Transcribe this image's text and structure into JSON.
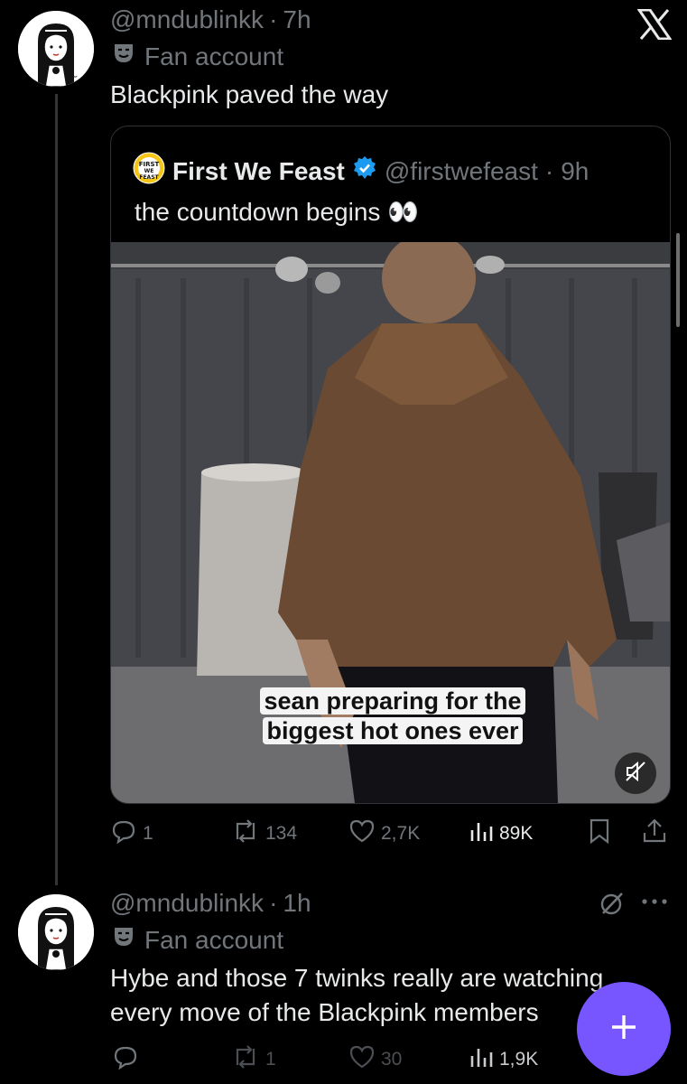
{
  "tweet1": {
    "handle": "@mndublinkk",
    "sep": "·",
    "time": "7h",
    "fan_label": "Fan account",
    "text": "Blackpink paved the way"
  },
  "quote": {
    "name": "First We Feast",
    "handle": "@firstwefeast",
    "sep": "·",
    "time": "9h",
    "text": "the countdown begins 👀",
    "caption_line1": "sean preparing for the",
    "caption_line2": "biggest hot ones ever",
    "avatar_text": "FIRST WE FEAST"
  },
  "tweet1_actions": {
    "replies": "1",
    "reposts": "134",
    "likes": "2,7K",
    "views": "89K"
  },
  "tweet2": {
    "handle": "@mndublinkk",
    "sep": "·",
    "time": "1h",
    "fan_label": "Fan account",
    "text_line1": "Hybe and those 7 twinks really are watching",
    "text_line2": "every move of the Blackpink members"
  },
  "tweet2_actions": {
    "reposts": "1",
    "likes": "30",
    "views": "1,9K"
  },
  "colors": {
    "background": "#000000",
    "text": "#e7e9ea",
    "muted": "#71767b",
    "accent": "#7856ff",
    "verified": "#1d9bf0"
  },
  "icons": [
    "x-logo-icon",
    "theater-mask-icon",
    "verified-badge-icon",
    "reply-icon",
    "repost-icon",
    "like-icon",
    "views-icon",
    "bookmark-icon",
    "share-icon",
    "grok-icon",
    "more-icon",
    "mute-icon",
    "plus-icon"
  ]
}
